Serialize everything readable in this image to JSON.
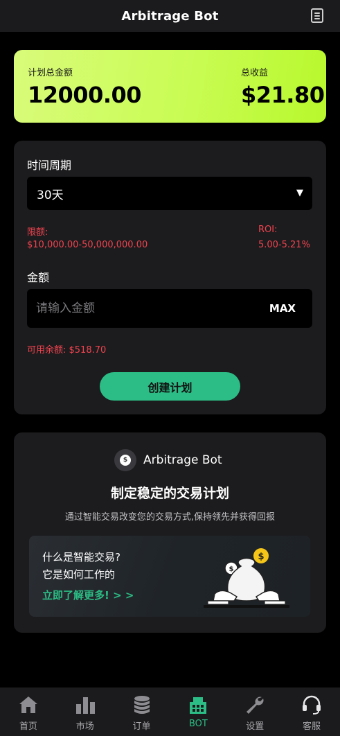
{
  "header": {
    "title": "Arbitrage Bot",
    "menu_icon": "document-icon"
  },
  "summary": {
    "plan_total_label": "计划总金额",
    "plan_total_value": "12000.00",
    "total_profit_label": "总收益",
    "total_profit_value": "$21.80"
  },
  "form": {
    "period_label": "时间周期",
    "period_selected": "30天",
    "limit_label": "限额:",
    "limit_value": "$10,000.00-50,000,000.00",
    "roi_label": "ROI:",
    "roi_value": "5.00-5.21%",
    "amount_label": "金额",
    "amount_placeholder": "请输入金额",
    "max_label": "MAX",
    "available_balance": "可用余额: $518.70",
    "create_button": "创建计划"
  },
  "info": {
    "brand_name": "Arbitrage Bot",
    "headline": "制定稳定的交易计划",
    "subtitle": "通过智能交易改变您的交易方式,保持领先并获得回报",
    "promo_question_1": "什么是智能交易?",
    "promo_question_2": "它是如何工作的",
    "promo_link": "立即了解更多! > >"
  },
  "tabs": [
    {
      "label": "首页",
      "icon": "home-icon",
      "active": false
    },
    {
      "label": "市场",
      "icon": "bar-chart-icon",
      "active": false
    },
    {
      "label": "订单",
      "icon": "coin-stack-icon",
      "active": false
    },
    {
      "label": "BOT",
      "icon": "bot-icon",
      "active": true
    },
    {
      "label": "设置",
      "icon": "wrench-icon",
      "active": false
    },
    {
      "label": "客服",
      "icon": "headset-icon",
      "active": false
    }
  ],
  "colors": {
    "accent_green": "#2bbd85",
    "limit_red": "#f1434f",
    "summary_gradient_start": "#d9fb7a",
    "summary_gradient_end": "#b8f82c"
  }
}
